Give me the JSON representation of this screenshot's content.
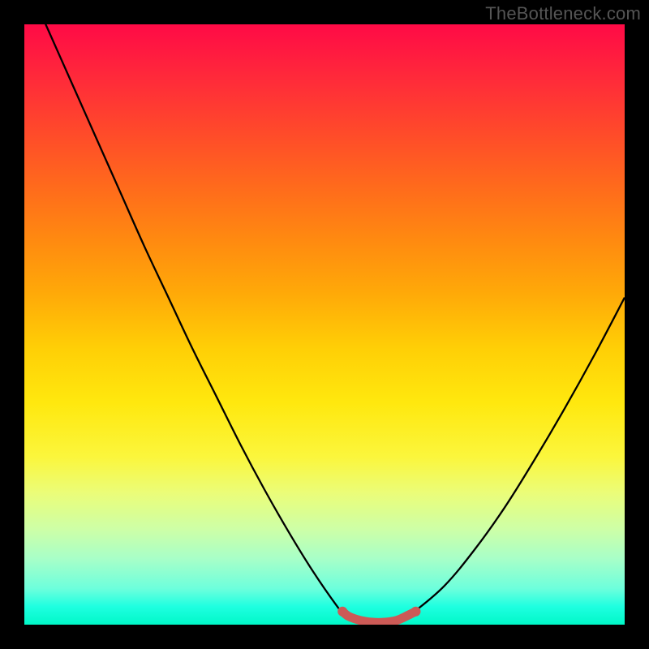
{
  "watermark": "TheBottleneck.com",
  "chart_data": {
    "type": "line",
    "title": "",
    "xlabel": "",
    "ylabel": "",
    "xlim": [
      0,
      100
    ],
    "ylim": [
      0,
      100
    ],
    "grid": false,
    "legend": false,
    "series": [
      {
        "name": "bottleneck-curve",
        "x": [
          0,
          4,
          8,
          12,
          16,
          20,
          24,
          28,
          32,
          36,
          40,
          44,
          48,
          52,
          53,
          55,
          60,
          63,
          65,
          70,
          75,
          80,
          85,
          90,
          95,
          100
        ],
        "y": [
          108,
          99,
          90,
          81,
          72,
          63,
          54.5,
          46,
          38,
          30,
          22.5,
          15.5,
          9,
          3.2,
          2.2,
          0.9,
          0.4,
          0.9,
          2.2,
          6.5,
          12.5,
          19.5,
          27.5,
          36,
          45,
          54.5
        ],
        "stroke": "#000000"
      },
      {
        "name": "optimal-segment",
        "x": [
          53.0,
          54.0,
          56.0,
          58.0,
          60.0,
          62.0,
          64.0,
          65.2
        ],
        "y": [
          2.2,
          1.4,
          0.7,
          0.4,
          0.4,
          0.7,
          1.6,
          2.2
        ],
        "stroke": "#cc5a56"
      }
    ],
    "gradient_stops": [
      {
        "pos": 0.0,
        "color": "#ff0a46"
      },
      {
        "pos": 0.5,
        "color": "#ffcf06"
      },
      {
        "pos": 0.78,
        "color": "#ebfd78"
      },
      {
        "pos": 1.0,
        "color": "#00f8c8"
      }
    ]
  }
}
